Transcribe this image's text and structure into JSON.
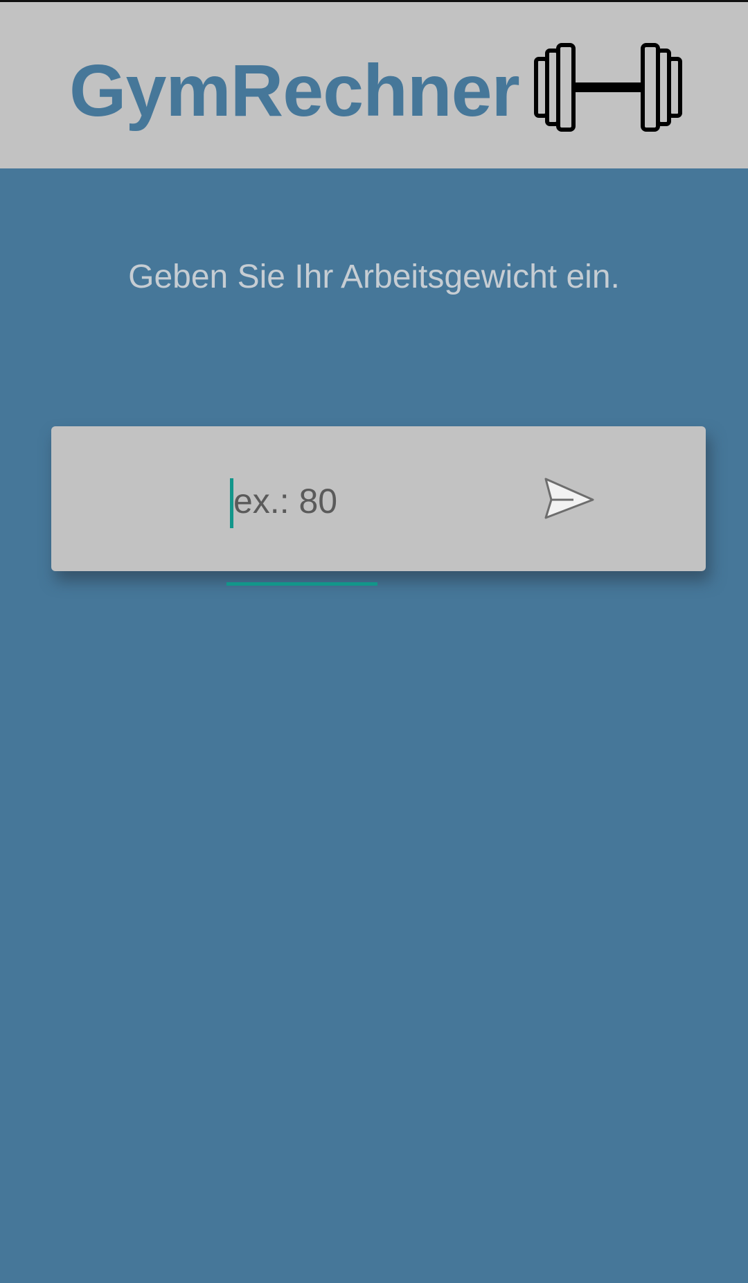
{
  "header": {
    "title": "GymRechner",
    "logo_icon": "dumbbell-icon"
  },
  "main": {
    "instruction": "Geben Sie Ihr Arbeitsgewicht ein.",
    "weight_input": {
      "placeholder": "ex.: 80",
      "value": ""
    },
    "send_icon": "send-paper-plane-icon"
  },
  "colors": {
    "background": "#467799",
    "header_background": "#c2c2c2",
    "title_color": "#467799",
    "instruction_text": "#c6cdd3",
    "card_background": "#c2c2c2",
    "input_accent": "#12968a"
  }
}
